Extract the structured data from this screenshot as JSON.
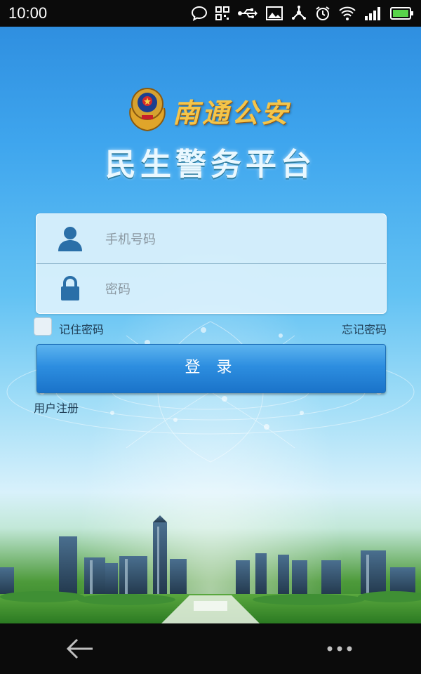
{
  "status_bar": {
    "time": "10:00",
    "icons": [
      "chat-bubble-icon",
      "qr-code-icon",
      "usb-icon",
      "image-icon",
      "network-share-icon",
      "alarm-icon",
      "wifi-icon",
      "signal-icon",
      "battery-icon"
    ]
  },
  "header": {
    "brand_name": "南通公安",
    "app_title": "民生警务平台"
  },
  "login_form": {
    "phone_placeholder": "手机号码",
    "phone_value": "",
    "password_placeholder": "密码",
    "password_value": "",
    "remember_label": "记住密码",
    "remember_checked": false,
    "forgot_label": "忘记密码",
    "login_label": "登 录",
    "register_label": "用户注册"
  },
  "nav_bar": {
    "icons": [
      "back-arrow-icon",
      "more-dots-icon"
    ]
  },
  "colors": {
    "accent": "#1a73c9",
    "brand_gold": "#f4c54a",
    "text_dark": "#1f3d55"
  }
}
